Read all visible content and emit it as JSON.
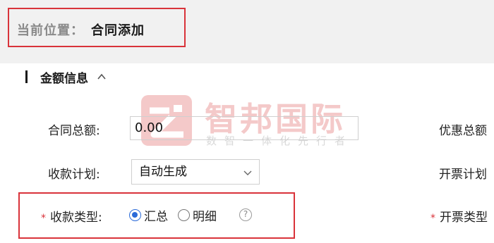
{
  "breadcrumb": {
    "label": "当前位置：",
    "current": "合同添加"
  },
  "section": {
    "title": "金额信息",
    "collapse_icon": "chevron-up-icon"
  },
  "watermark": {
    "title": "智邦国际",
    "subtitle": "数智一体化先行者"
  },
  "form": {
    "contract_total": {
      "label": "合同总额:",
      "value": "0.00"
    },
    "discount_total": {
      "label": "优惠总额"
    },
    "payment_plan": {
      "label": "收款计划:",
      "selected": "自动生成"
    },
    "invoice_plan": {
      "label": "开票计划"
    },
    "payment_type": {
      "required_mark": "*",
      "label": "收款类型:",
      "options": [
        {
          "label": "汇总",
          "checked": true
        },
        {
          "label": "明细",
          "checked": false
        }
      ],
      "help_symbol": "?"
    },
    "invoice_type": {
      "required_mark": "*",
      "label": "开票类型"
    }
  },
  "colors": {
    "highlight": "#d9333a",
    "radio_accent": "#2a6ad8",
    "watermark": "#f4c9c9",
    "topbar_bg": "#f1f1f1"
  }
}
